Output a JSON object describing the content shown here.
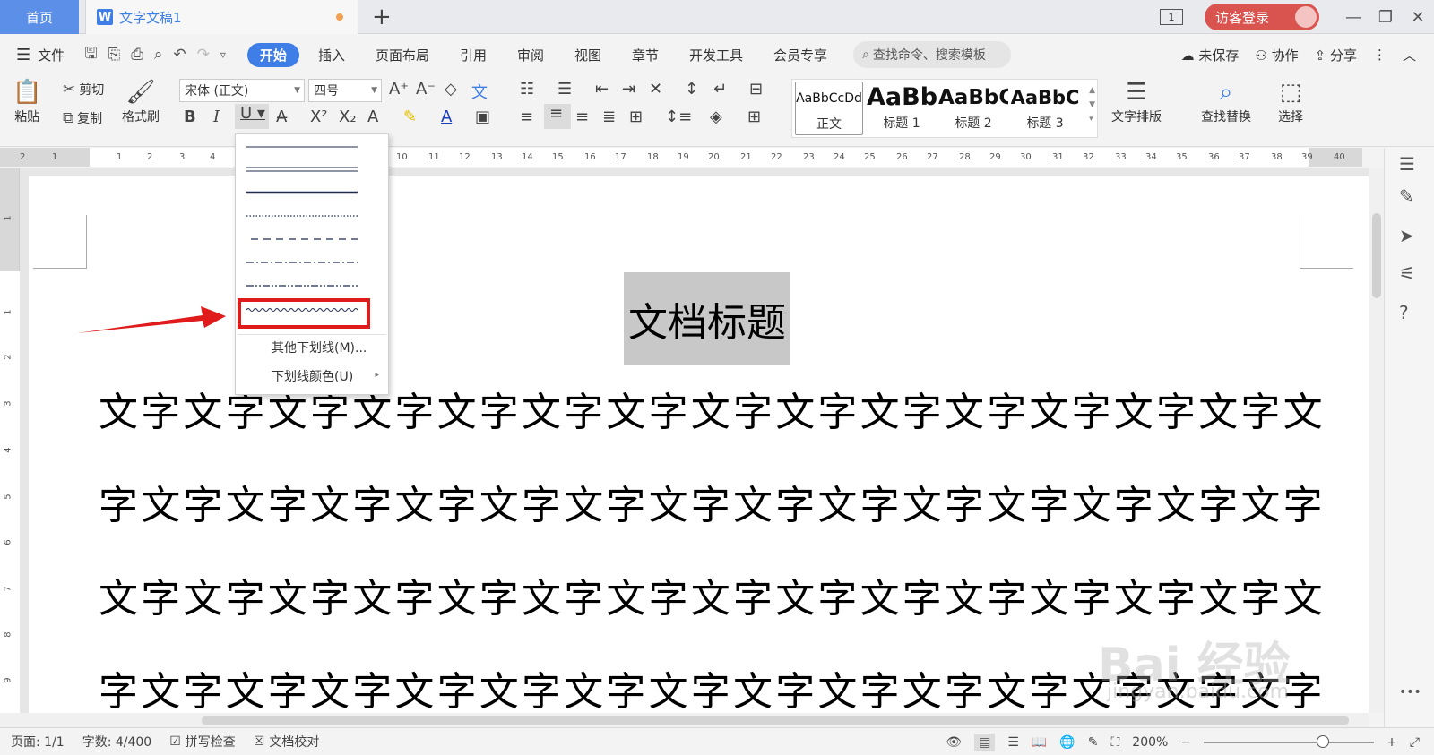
{
  "titlebar": {
    "home_tab": "首页",
    "doc_tab": "文字文稿1",
    "doc_icon": "W",
    "new_tab": "+",
    "window_count": "1",
    "login": "访客登录",
    "minimize": "—",
    "restore": "❐",
    "close": "✕"
  },
  "menubar": {
    "file": "文件",
    "tabs": [
      "开始",
      "插入",
      "页面布局",
      "引用",
      "审阅",
      "视图",
      "章节",
      "开发工具",
      "会员专享"
    ],
    "search_placeholder": "查找命令、搜索模板",
    "unsaved": "未保存",
    "collaborate": "协作",
    "share": "分享"
  },
  "ribbon": {
    "paste": "粘贴",
    "cut": "剪切",
    "copy": "复制",
    "format_painter": "格式刷",
    "font_name": "宋体 (正文)",
    "font_size": "四号",
    "styles": [
      {
        "preview": "AaBbCcDd",
        "label": "正文"
      },
      {
        "preview": "AaBb",
        "label": "标题 1"
      },
      {
        "preview": "AaBbC",
        "label": "标题 2"
      },
      {
        "preview": "AaBbC",
        "label": "标题 3"
      }
    ],
    "text_layout": "文字排版",
    "find_replace": "查找替换",
    "select": "选择"
  },
  "underline_menu": {
    "more": "其他下划线(M)...",
    "color": "下划线颜色(U)"
  },
  "document": {
    "title": "文档标题",
    "lines": [
      "文字文字文字文字文字文字文字文字文字文字文字文字文字文字文",
      "字文字文字文字文字文字文字文字文字文字文字文字文字文字文字",
      "文字文字文字文字文字文字文字文字文字文字文字文字文字文字文",
      "字文字文字文字文字文字文字文字文字文字文字文字文字文字文字"
    ]
  },
  "statusbar": {
    "page": "页面: 1/1",
    "words": "字数: 4/400",
    "spell": "拼写检查",
    "proof": "文档校对",
    "zoom": "200%"
  },
  "watermark": {
    "main": "Bai 经验",
    "sub": "jingyan.baidu.com"
  },
  "colors": {
    "accent": "#3f7ee6",
    "highlight_box": "#e01b1b",
    "login_bg": "#d9534f"
  }
}
